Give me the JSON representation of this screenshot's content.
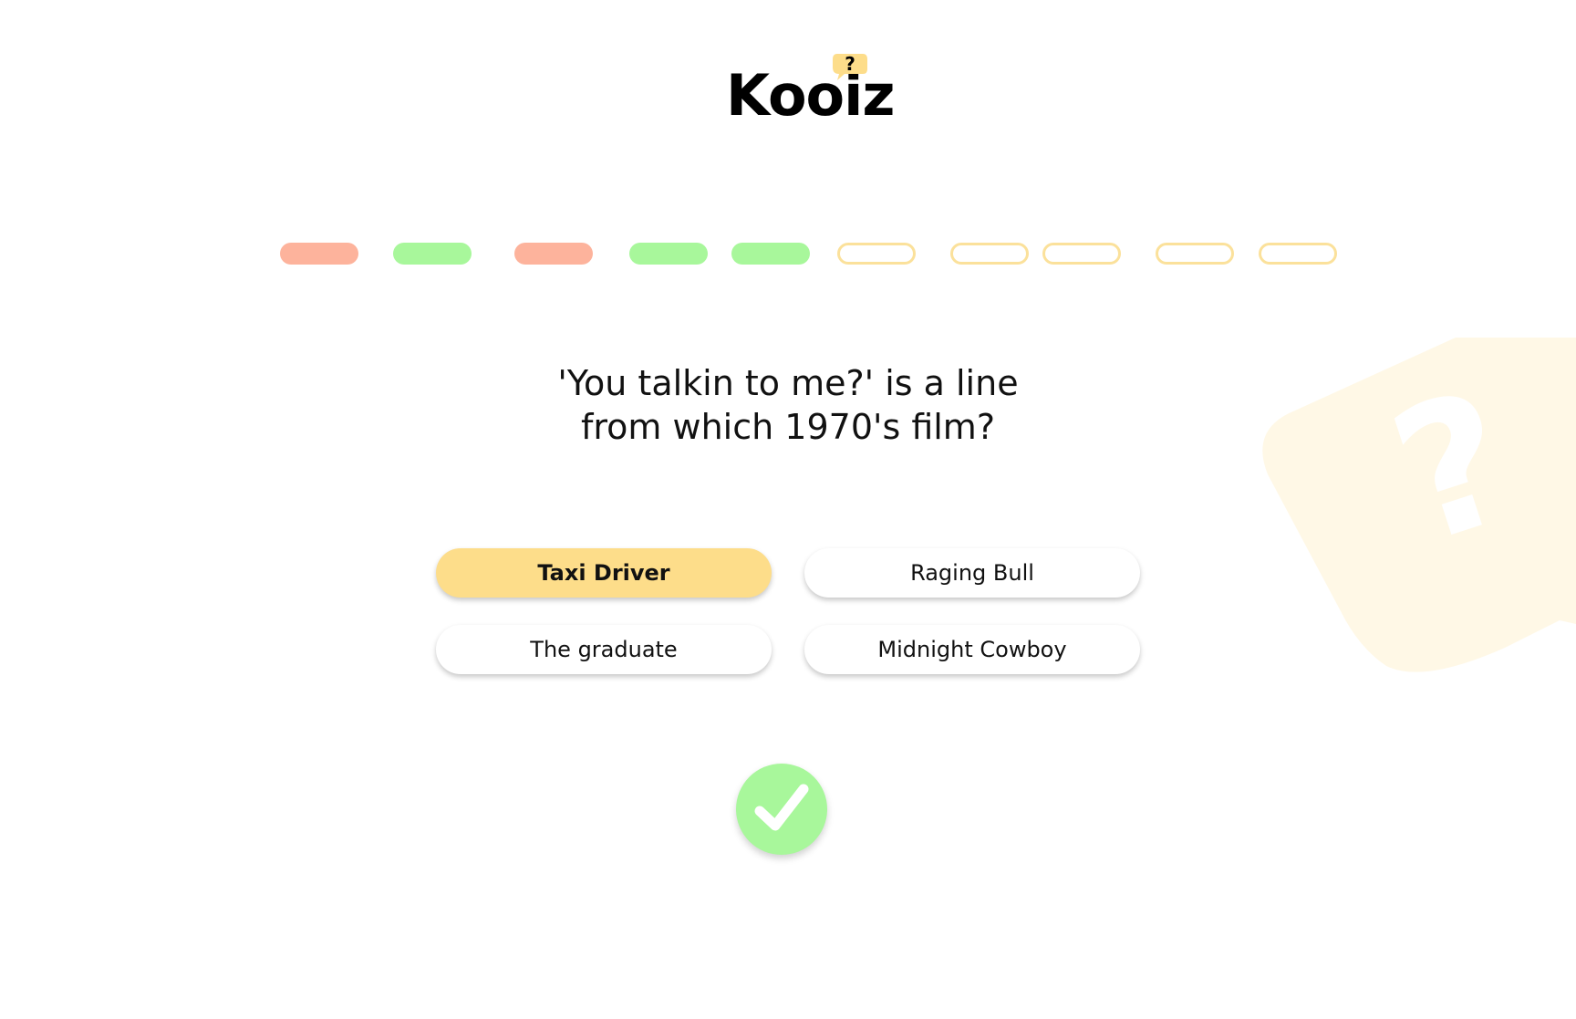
{
  "logo": {
    "text": "Kooiz",
    "badge_glyph": "?"
  },
  "progress": {
    "segments": [
      "wrong",
      "correct",
      "wrong",
      "correct",
      "correct",
      "pending",
      "pending",
      "pending",
      "pending",
      "pending"
    ]
  },
  "question": {
    "line1": "'You talkin to me?' is a line",
    "line2": "from which 1970's film?"
  },
  "answers": [
    {
      "label": "Taxi Driver",
      "selected": true
    },
    {
      "label": "Raging Bull",
      "selected": false
    },
    {
      "label": "The graduate",
      "selected": false
    },
    {
      "label": "Midnight Cowboy",
      "selected": false
    }
  ],
  "result": {
    "status": "correct",
    "icon": "checkmark-icon"
  },
  "background": {
    "icon": "question-bubble-icon"
  },
  "colors": {
    "wrong": "#fdb39c",
    "correct": "#a8f79b",
    "pending_border": "#fbe19b",
    "selected": "#fddd8a",
    "bubble_bg": "#fff8e6"
  }
}
